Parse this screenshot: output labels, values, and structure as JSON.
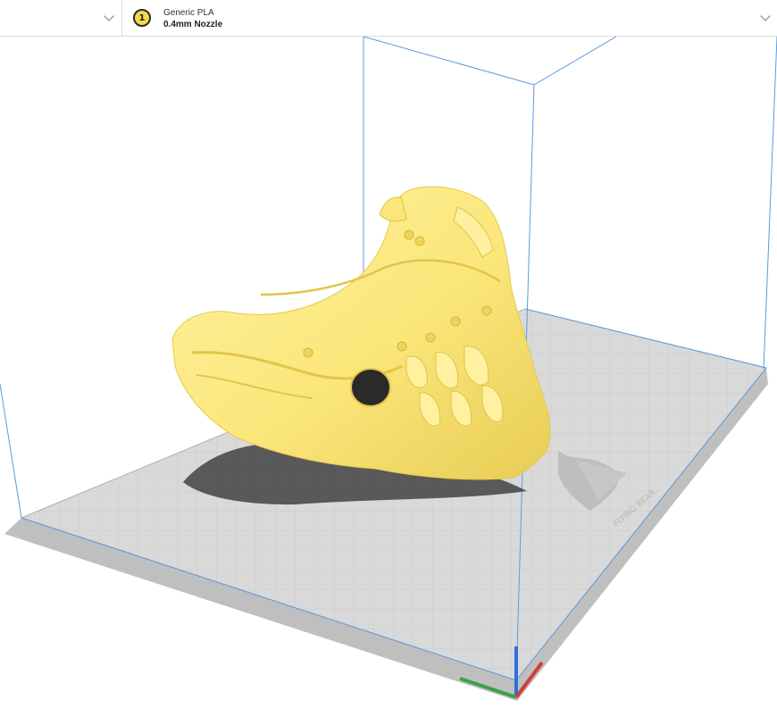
{
  "header": {
    "extruder": {
      "index": "1",
      "material": "Generic PLA",
      "nozzle": "0.4mm Nozzle",
      "badge_color": "#f7d84a"
    },
    "left_selector_icon": "chevron-down-icon",
    "extruder_selector_icon": "chevron-down-icon"
  },
  "viewport": {
    "model_color": "#fbe67a",
    "build_plate_color": "#d9d9d9",
    "volume_outline_color": "#5a9be0",
    "axis_colors": {
      "x": "#d23c3c",
      "y": "#3aa14a",
      "z": "#2f6fdc"
    },
    "plate_logo_text": "FLYING BEAR"
  }
}
